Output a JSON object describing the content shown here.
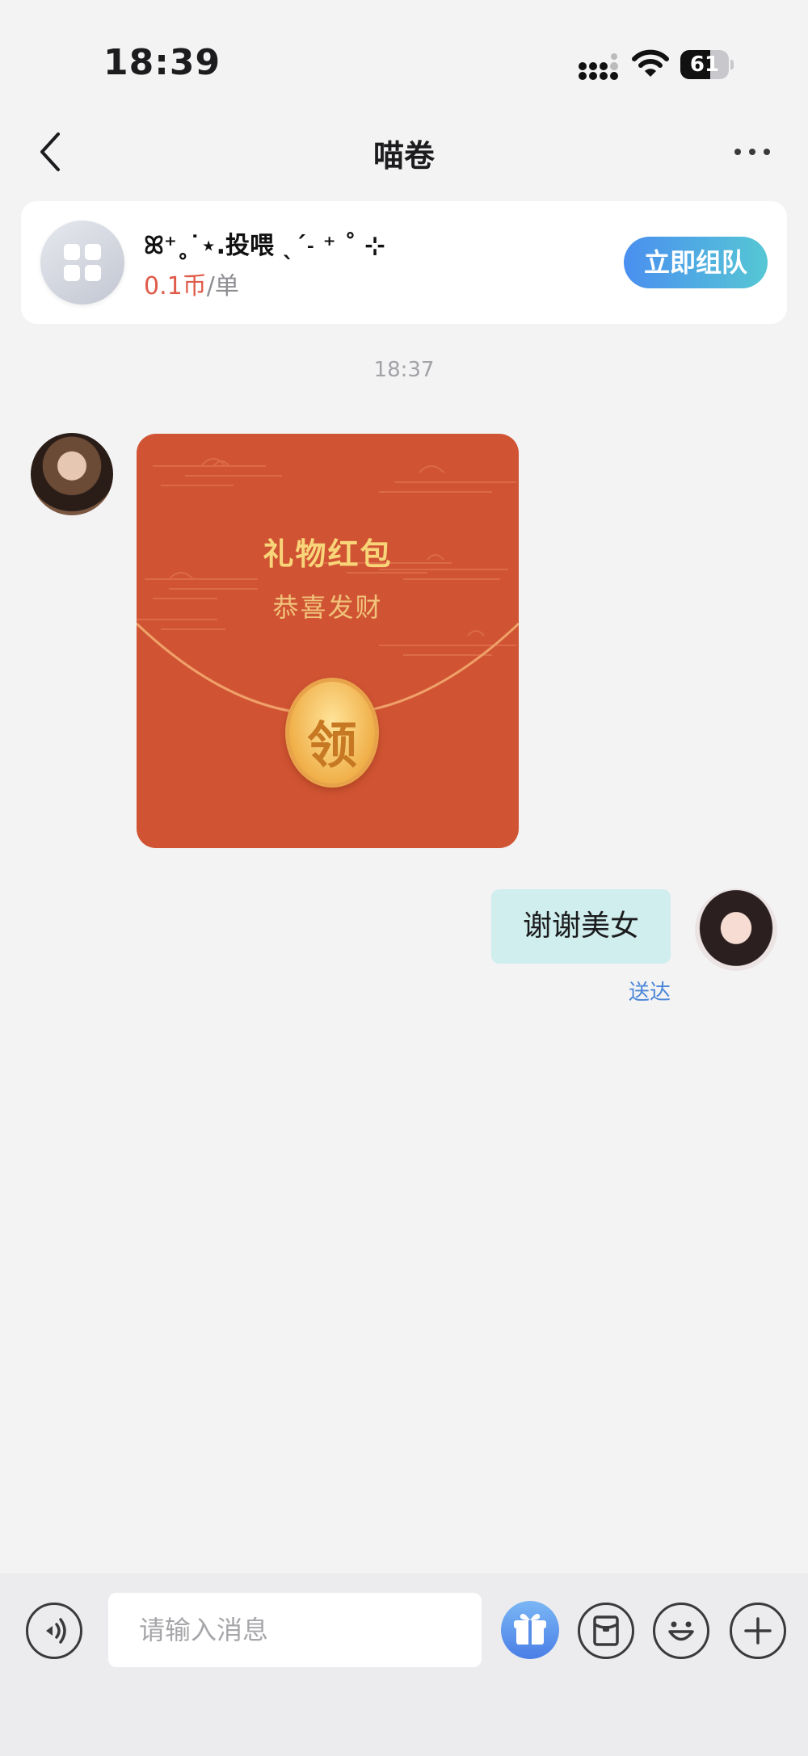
{
  "status_bar": {
    "time": "18:39",
    "battery_level": "61",
    "battery_fraction": 0.61
  },
  "nav": {
    "title": "喵卷",
    "back_icon": "chevron-left-icon",
    "more_icon": "more-horizontal-icon"
  },
  "order_card": {
    "title": "ꕤ⁺˳˙⋆.投喂 ˎˊ˗ ⁺ ˚ ⊹",
    "price": "0.1币",
    "unit": "/单",
    "action_label": "立即组队",
    "icon": "grid-icon"
  },
  "chat": {
    "timestamp": "18:37",
    "messages": [
      {
        "type": "red_packet",
        "side": "left",
        "title": "礼物红包",
        "subtitle": "恭喜发财",
        "claim_label": "领"
      },
      {
        "type": "text",
        "side": "right",
        "text": "谢谢美女",
        "status": "送达"
      }
    ]
  },
  "input_bar": {
    "placeholder": "请输入消息",
    "value": "",
    "icons": [
      "voice-icon",
      "gift-icon",
      "red-packet-icon",
      "emoji-icon",
      "plus-icon"
    ]
  },
  "colors": {
    "accent_gradient_start": "#4a8ff0",
    "accent_gradient_end": "#56c7d4",
    "price_red": "#e05b4a",
    "red_packet": "#d05433",
    "bubble_self": "#cfeeed",
    "delivered_blue": "#4a86d8"
  }
}
